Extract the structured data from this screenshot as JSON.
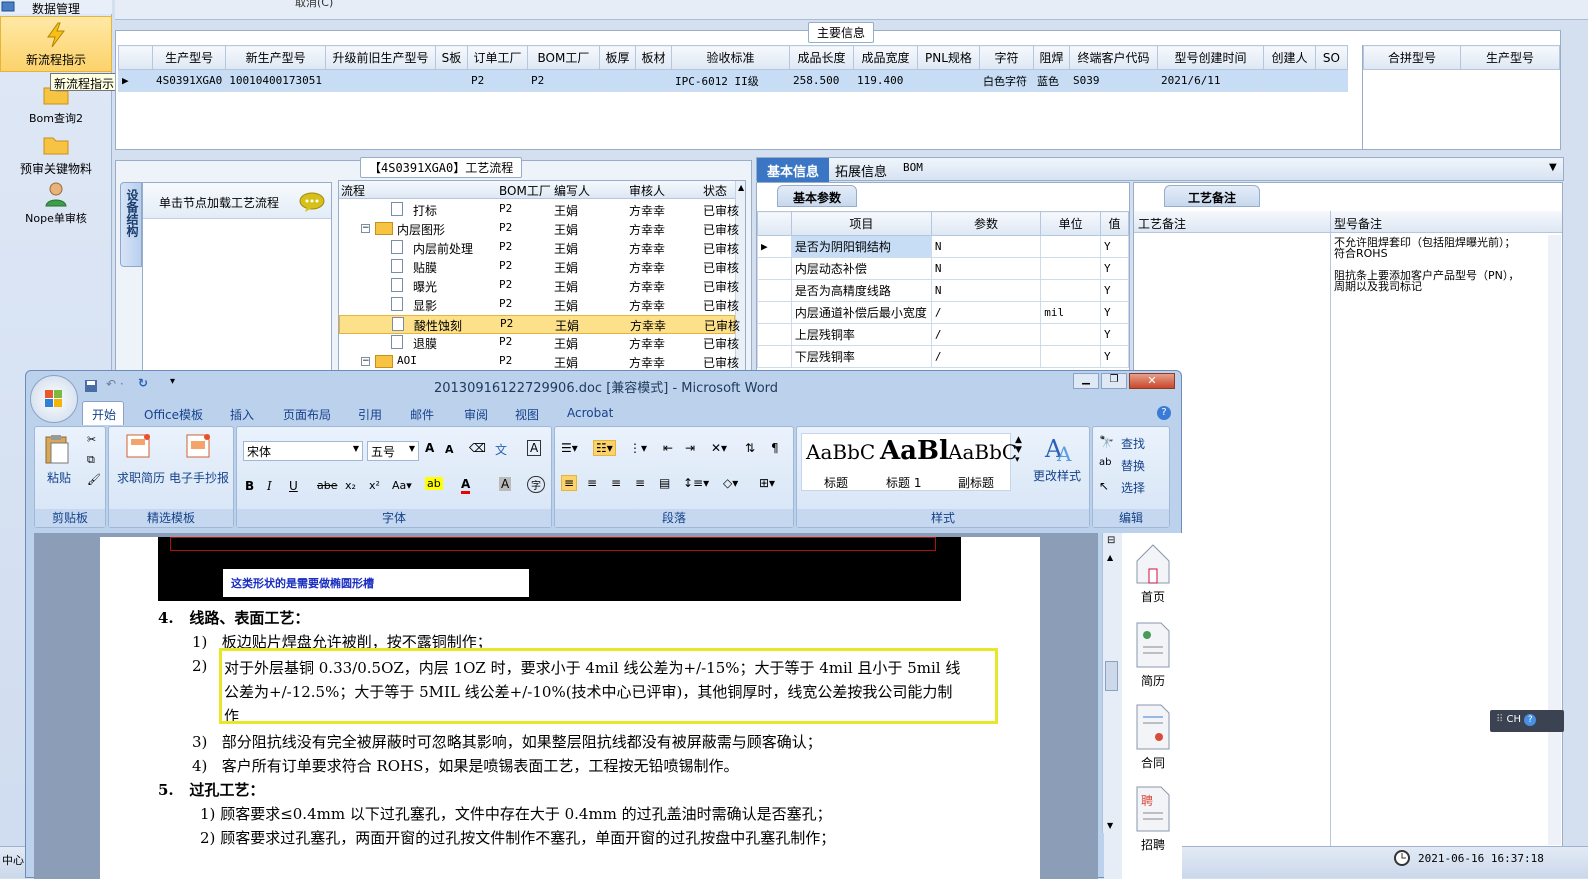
{
  "left_nav": {
    "top_label": "数据管理",
    "items": [
      {
        "label": "新流程指示",
        "icon": "lightning-icon"
      },
      {
        "label": "Bom查询2",
        "icon": "folder-icon"
      },
      {
        "label": "预审关键物料",
        "icon": "folder-icon"
      },
      {
        "label": "Nope单审核",
        "icon": "user-icon"
      }
    ],
    "tooltip": "新流程指示"
  },
  "top_cut_text": "取消(C)",
  "main_info": {
    "title": "主要信息",
    "columns": [
      "生产型号",
      "新生产型号",
      "升级前旧生产型号",
      "S板",
      "订单工厂",
      "BOM工厂",
      "板厚",
      "板材",
      "验收标准",
      "成品长度",
      "成品宽度",
      "PNL规格",
      "字符",
      "阻焊",
      "终端客户代码",
      "型号创建时间",
      "创建人",
      "SO"
    ],
    "row": [
      "4S0391XGA0",
      "10010400173051",
      "",
      "",
      "P2",
      "P2",
      "",
      "",
      "IPC-6012 II级",
      "258.500",
      "119.400",
      "",
      "白色字符",
      "蓝色",
      "S039",
      "2021/6/11",
      "",
      ""
    ],
    "side_columns": [
      "合拼型号",
      "生产型号"
    ]
  },
  "process": {
    "title": "【4S0391XGA0】工艺流程",
    "side_tab": "设备结构",
    "hint": "单击节点加载工艺流程",
    "columns": [
      "流程",
      "BOM工厂",
      "编写人",
      "审核人",
      "状态"
    ],
    "rows": [
      {
        "name": "打标",
        "bom": "P2",
        "author": "王娟",
        "reviewer": "方幸幸",
        "status": "已审核"
      },
      {
        "name": "内层图形",
        "bom": "P2",
        "author": "王娟",
        "reviewer": "方幸幸",
        "status": "已审核"
      },
      {
        "name": "内层前处理",
        "bom": "P2",
        "author": "王娟",
        "reviewer": "方幸幸",
        "status": "已审核"
      },
      {
        "name": "贴膜",
        "bom": "P2",
        "author": "王娟",
        "reviewer": "方幸幸",
        "status": "已审核"
      },
      {
        "name": "曝光",
        "bom": "P2",
        "author": "王娟",
        "reviewer": "方幸幸",
        "status": "已审核"
      },
      {
        "name": "显影",
        "bom": "P2",
        "author": "王娟",
        "reviewer": "方幸幸",
        "status": "已审核"
      },
      {
        "name": "酸性蚀刻",
        "bom": "P2",
        "author": "王娟",
        "reviewer": "方幸幸",
        "status": "已审核"
      },
      {
        "name": "退膜",
        "bom": "P2",
        "author": "王娟",
        "reviewer": "方幸幸",
        "status": "已审核"
      },
      {
        "name": "AOI",
        "bom": "P2",
        "author": "王娟",
        "reviewer": "方幸幸",
        "status": "已审核"
      }
    ]
  },
  "info_tabs": [
    "基本信息",
    "拓展信息",
    "BOM"
  ],
  "basic_params": {
    "title": "基本参数",
    "columns": [
      "项目",
      "参数",
      "单位",
      "值"
    ],
    "rows": [
      {
        "item": "是否为阴阳铜结构",
        "param": "N",
        "unit": "",
        "flag": "Y"
      },
      {
        "item": "内层动态补偿",
        "param": "N",
        "unit": "",
        "flag": "Y"
      },
      {
        "item": "是否为高精度线路",
        "param": "N",
        "unit": "",
        "flag": "Y"
      },
      {
        "item": "内层通道补偿后最小宽度",
        "param": "/",
        "unit": "mil",
        "flag": "Y"
      },
      {
        "item": "上层残铜率",
        "param": "/",
        "unit": "",
        "flag": "Y"
      },
      {
        "item": "下层残铜率",
        "param": "/",
        "unit": "",
        "flag": "Y"
      }
    ]
  },
  "remarks": {
    "tab": "工艺备注",
    "col1": "工艺备注",
    "col2": "型号备注",
    "note_lines": [
      "不允许阻焊套印（包括阻焊曝光前）；",
      "符合ROHS",
      "",
      "阻抗条上要添加客户产品型号（PN），",
      "周期以及我司标记"
    ]
  },
  "status_bar": {
    "left": "中心",
    "time": "2021-06-16 16:37:18",
    "ime": "CH"
  },
  "word": {
    "title": "20130916122729906.doc [兼容模式] - Microsoft Word",
    "tabs": [
      "开始",
      "Office模板",
      "插入",
      "页面布局",
      "引用",
      "邮件",
      "审阅",
      "视图",
      "Acrobat"
    ],
    "groups": {
      "clipboard": {
        "label": "剪贴板",
        "paste": "粘贴"
      },
      "templates": {
        "label": "精选模板",
        "btn1": "求职简历",
        "btn2": "电子手抄报"
      },
      "font": {
        "label": "字体",
        "name": "宋体",
        "size": "五号"
      },
      "paragraph": {
        "label": "段落"
      },
      "styles": {
        "label": "样式",
        "s1": "标题",
        "s2": "标题 1",
        "s3": "副标题",
        "sample1": "AaBbC",
        "sample2": "AaBl",
        "sample3": "AaBbC",
        "change": "更改样式"
      },
      "edit": {
        "label": "编辑",
        "find": "查找",
        "replace": "替换",
        "select": "选择"
      }
    },
    "right_sidebar": [
      "首页",
      "简历",
      "合同",
      "招聘"
    ],
    "image_caption": "这类形状的是需要做椭圆形槽",
    "lines": [
      {
        "num": "4.",
        "text": "线路、表面工艺："
      },
      {
        "num": "1)",
        "text": "板边贴片焊盘允许被削，按不露铜制作；"
      },
      {
        "num": "2)",
        "text": "对于外层基铜 0.33/0.5OZ，内层 1OZ 时，要求小于 4mil 线公差为+/-15%；大于等于 4mil 且小于 5mil 线"
      },
      {
        "num": "",
        "text": "公差为+/-12.5%；大于等于 5MIL 线公差+/-10%(技术中心已评审)，其他铜厚时，线宽公差按我公司能力制"
      },
      {
        "num": "",
        "text": "作"
      },
      {
        "num": "3)",
        "text": "部分阻抗线没有完全被屏蔽时可忽略其影响，如果整层阻抗线都没有被屏蔽需与顾客确认；"
      },
      {
        "num": "4)",
        "text": "客户所有订单要求符合 ROHS，如果是喷锡表面工艺，工程按无铅喷锡制作。"
      },
      {
        "num": "5.",
        "text": "过孔工艺："
      },
      {
        "num": "1)",
        "text": "顾客要求≤0.4mm 以下过孔塞孔，文件中存在大于 0.4mm 的过孔盖油时需确认是否塞孔；"
      },
      {
        "num": "2)",
        "text": "顾客要求过孔塞孔，两面开窗的过孔按文件制作不塞孔，单面开窗的过孔按盘中孔塞孔制作；"
      }
    ]
  }
}
